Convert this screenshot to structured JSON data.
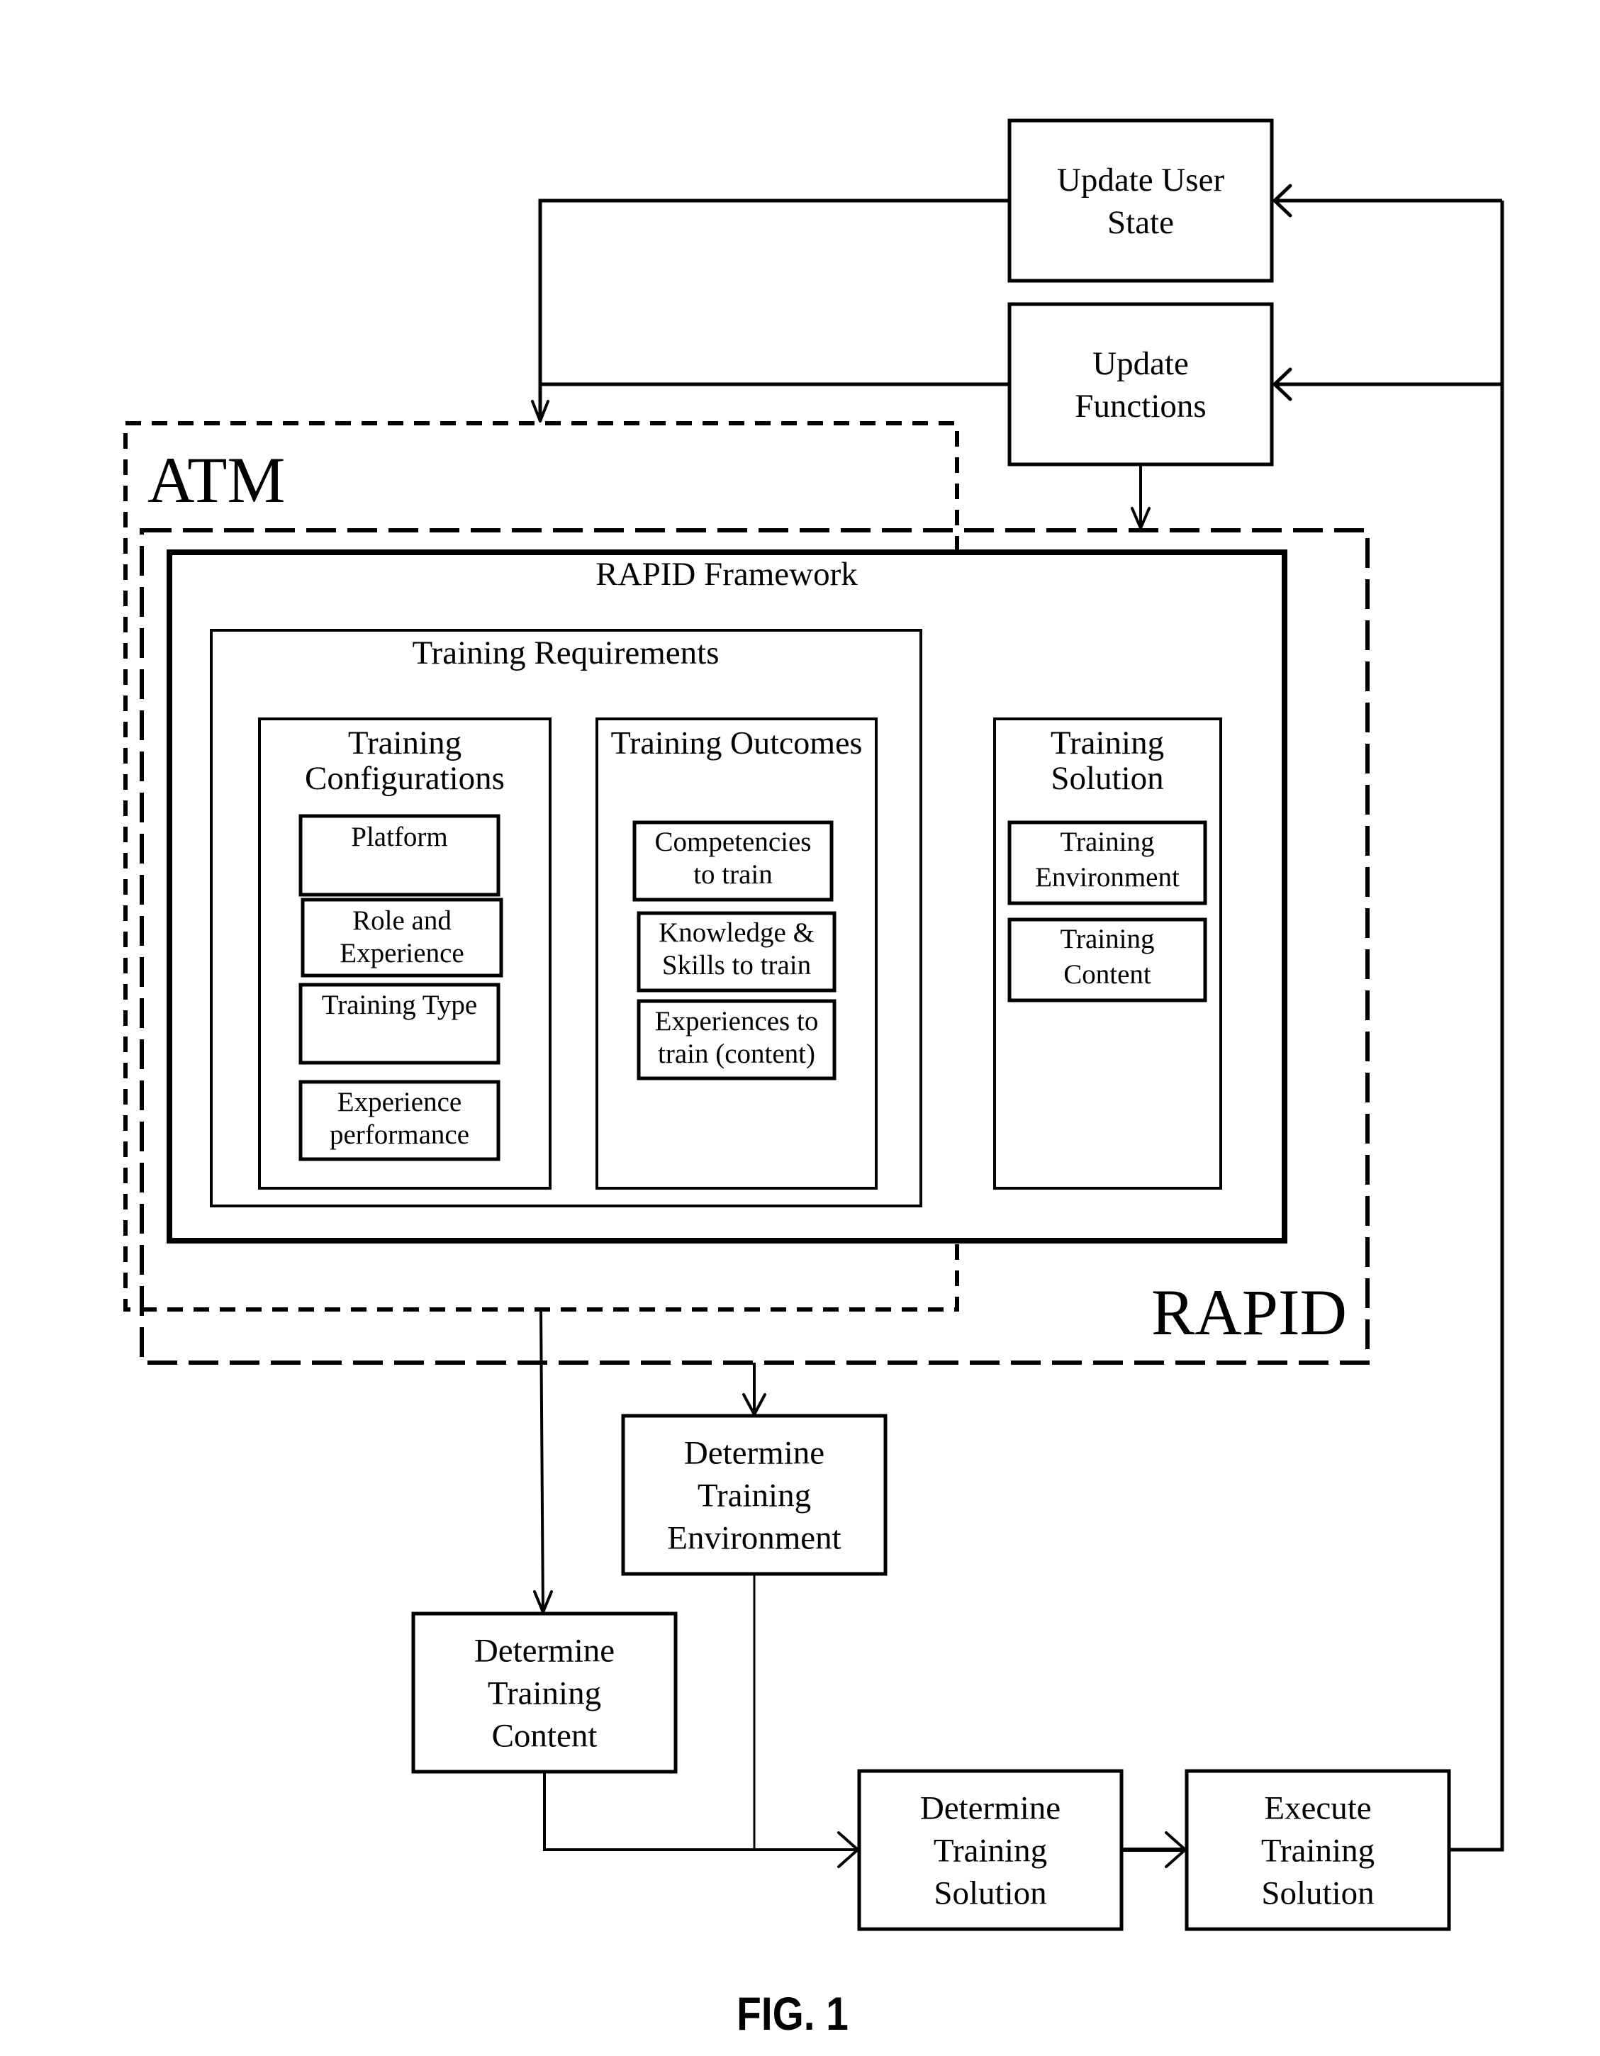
{
  "figure_label": "FIG. 1",
  "regions": {
    "atm": {
      "label": "ATM"
    },
    "rapid": {
      "label": "RAPID"
    }
  },
  "framework": {
    "title": "RAPID Framework",
    "training_requirements": {
      "title": "Training Requirements",
      "training_configurations": {
        "title_lines": [
          "Training",
          "Configurations"
        ],
        "items": [
          {
            "lines": [
              "Platform"
            ]
          },
          {
            "lines": [
              "Role and",
              "Experience"
            ]
          },
          {
            "lines": [
              "Training Type"
            ]
          },
          {
            "lines": [
              "Experience",
              "performance"
            ]
          }
        ]
      },
      "training_outcomes": {
        "title_lines": [
          "Training Outcomes"
        ],
        "items": [
          {
            "lines": [
              "Competencies",
              "to train"
            ]
          },
          {
            "lines": [
              "Knowledge &",
              "Skills to train"
            ]
          },
          {
            "lines": [
              "Experiences to",
              "train (content)"
            ]
          }
        ]
      }
    },
    "training_solution": {
      "title_lines": [
        "Training",
        "Solution"
      ],
      "items": [
        {
          "lines": [
            "Training",
            "Environment"
          ]
        },
        {
          "lines": [
            "Training",
            "Content"
          ]
        }
      ]
    }
  },
  "process_steps": {
    "update_user_state": {
      "lines": [
        "Update User",
        "State"
      ]
    },
    "update_functions": {
      "lines": [
        "Update",
        "Functions"
      ]
    },
    "determine_training_environment": {
      "lines": [
        "Determine",
        "Training",
        "Environment"
      ]
    },
    "determine_training_content": {
      "lines": [
        "Determine",
        "Training",
        "Content"
      ]
    },
    "determine_training_solution": {
      "lines": [
        "Determine",
        "Training",
        "Solution"
      ]
    },
    "execute_training_solution": {
      "lines": [
        "Execute",
        "Training",
        "Solution"
      ]
    }
  },
  "connections": [
    {
      "from": "execute_training_solution",
      "to": "update_user_state"
    },
    {
      "from": "execute_training_solution",
      "to": "update_functions"
    },
    {
      "from": "update_user_state",
      "to": "atm"
    },
    {
      "from": "update_functions",
      "to": "atm"
    },
    {
      "from": "update_functions",
      "to": "rapid"
    },
    {
      "from": "atm",
      "to": "determine_training_content"
    },
    {
      "from": "rapid",
      "to": "determine_training_environment"
    },
    {
      "from": "determine_training_content",
      "to": "determine_training_solution"
    },
    {
      "from": "determine_training_environment",
      "to": "determine_training_solution"
    },
    {
      "from": "determine_training_solution",
      "to": "execute_training_solution"
    }
  ]
}
